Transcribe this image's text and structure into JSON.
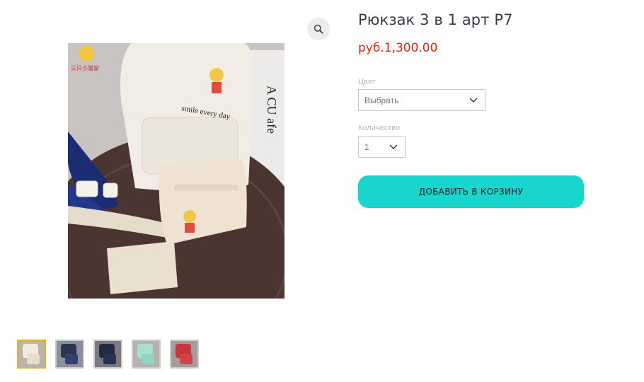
{
  "product": {
    "title": "Рюкзак 3 в 1 арт Р7",
    "price": "руб.1,300.00"
  },
  "options": {
    "color_label": "Цвет",
    "color_value": "Выбрать",
    "quantity_label": "Количество",
    "quantity_value": "1"
  },
  "actions": {
    "add_to_cart": "ДОБАВИТЬ В КОРЗИНУ"
  },
  "gallery": {
    "zoom_icon": "magnifier-icon",
    "main_image_text": {
      "bag_print": "smile every day",
      "shop_logo": "三只小猫家",
      "background_sign": "A CU afe"
    },
    "thumbnails": [
      {
        "name": "thumb-beige",
        "active": true,
        "color": "#d9cbb6"
      },
      {
        "name": "thumb-navy",
        "active": false,
        "color": "#2a3550"
      },
      {
        "name": "thumb-dark-navy",
        "active": false,
        "color": "#1f2a44"
      },
      {
        "name": "thumb-mint",
        "active": false,
        "color": "#9fd9c9"
      },
      {
        "name": "thumb-red",
        "active": false,
        "color": "#c8343a"
      }
    ]
  },
  "colors": {
    "accent": "#18d6ce",
    "price": "#e2231a",
    "active_thumb_border": "#e1b22b"
  }
}
